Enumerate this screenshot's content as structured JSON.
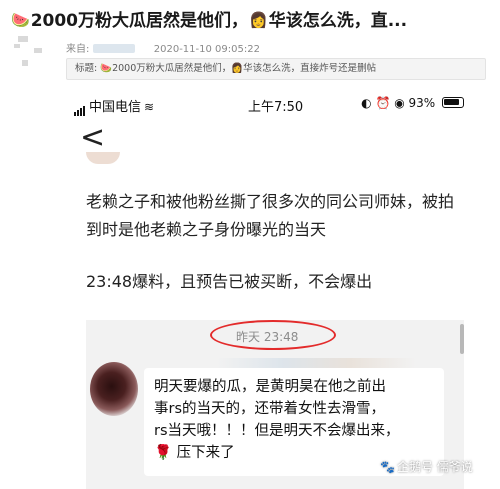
{
  "post": {
    "title_emoji_1": "🍉",
    "title_part_1": "2000万粉大瓜居然是他们，",
    "title_emoji_2": "👩",
    "title_part_2": "华该怎么洗，直...",
    "from_label": "来自:",
    "date": "2020-11-10 09:05:22",
    "title_box_label": "标题:",
    "title_box_emoji_1": "🍉",
    "title_box_part_1": "2000万粉大瓜居然是他们，",
    "title_box_emoji_2": "👩",
    "title_box_part_2": "华该怎么洗，直接炸号还是删帖"
  },
  "status_bar": {
    "carrier": "中国电信",
    "time": "上午7:50",
    "icons_text": "◐ ⏰ ◉ 93%"
  },
  "content": {
    "back_glyph": "<",
    "paragraph_1": "老赖之子和被他粉丝撕了很多次的同公司师妹，被拍到时是他老赖之子身份曝光的当天",
    "paragraph_2": "23:48爆料，且预告已被买断，不会爆出"
  },
  "chat": {
    "timestamp": "昨天 23:48",
    "message_lines": [
      "明天要爆的瓜，是黄明昊在他之前出",
      "事rs的当天的，还带着女性去滑雪，",
      "rs当天哦！！！但是明天不会爆出来，",
      "🌹 压下来了"
    ]
  },
  "watermark": {
    "paw": "🐾",
    "text": "企鹅号 儒爷说"
  }
}
